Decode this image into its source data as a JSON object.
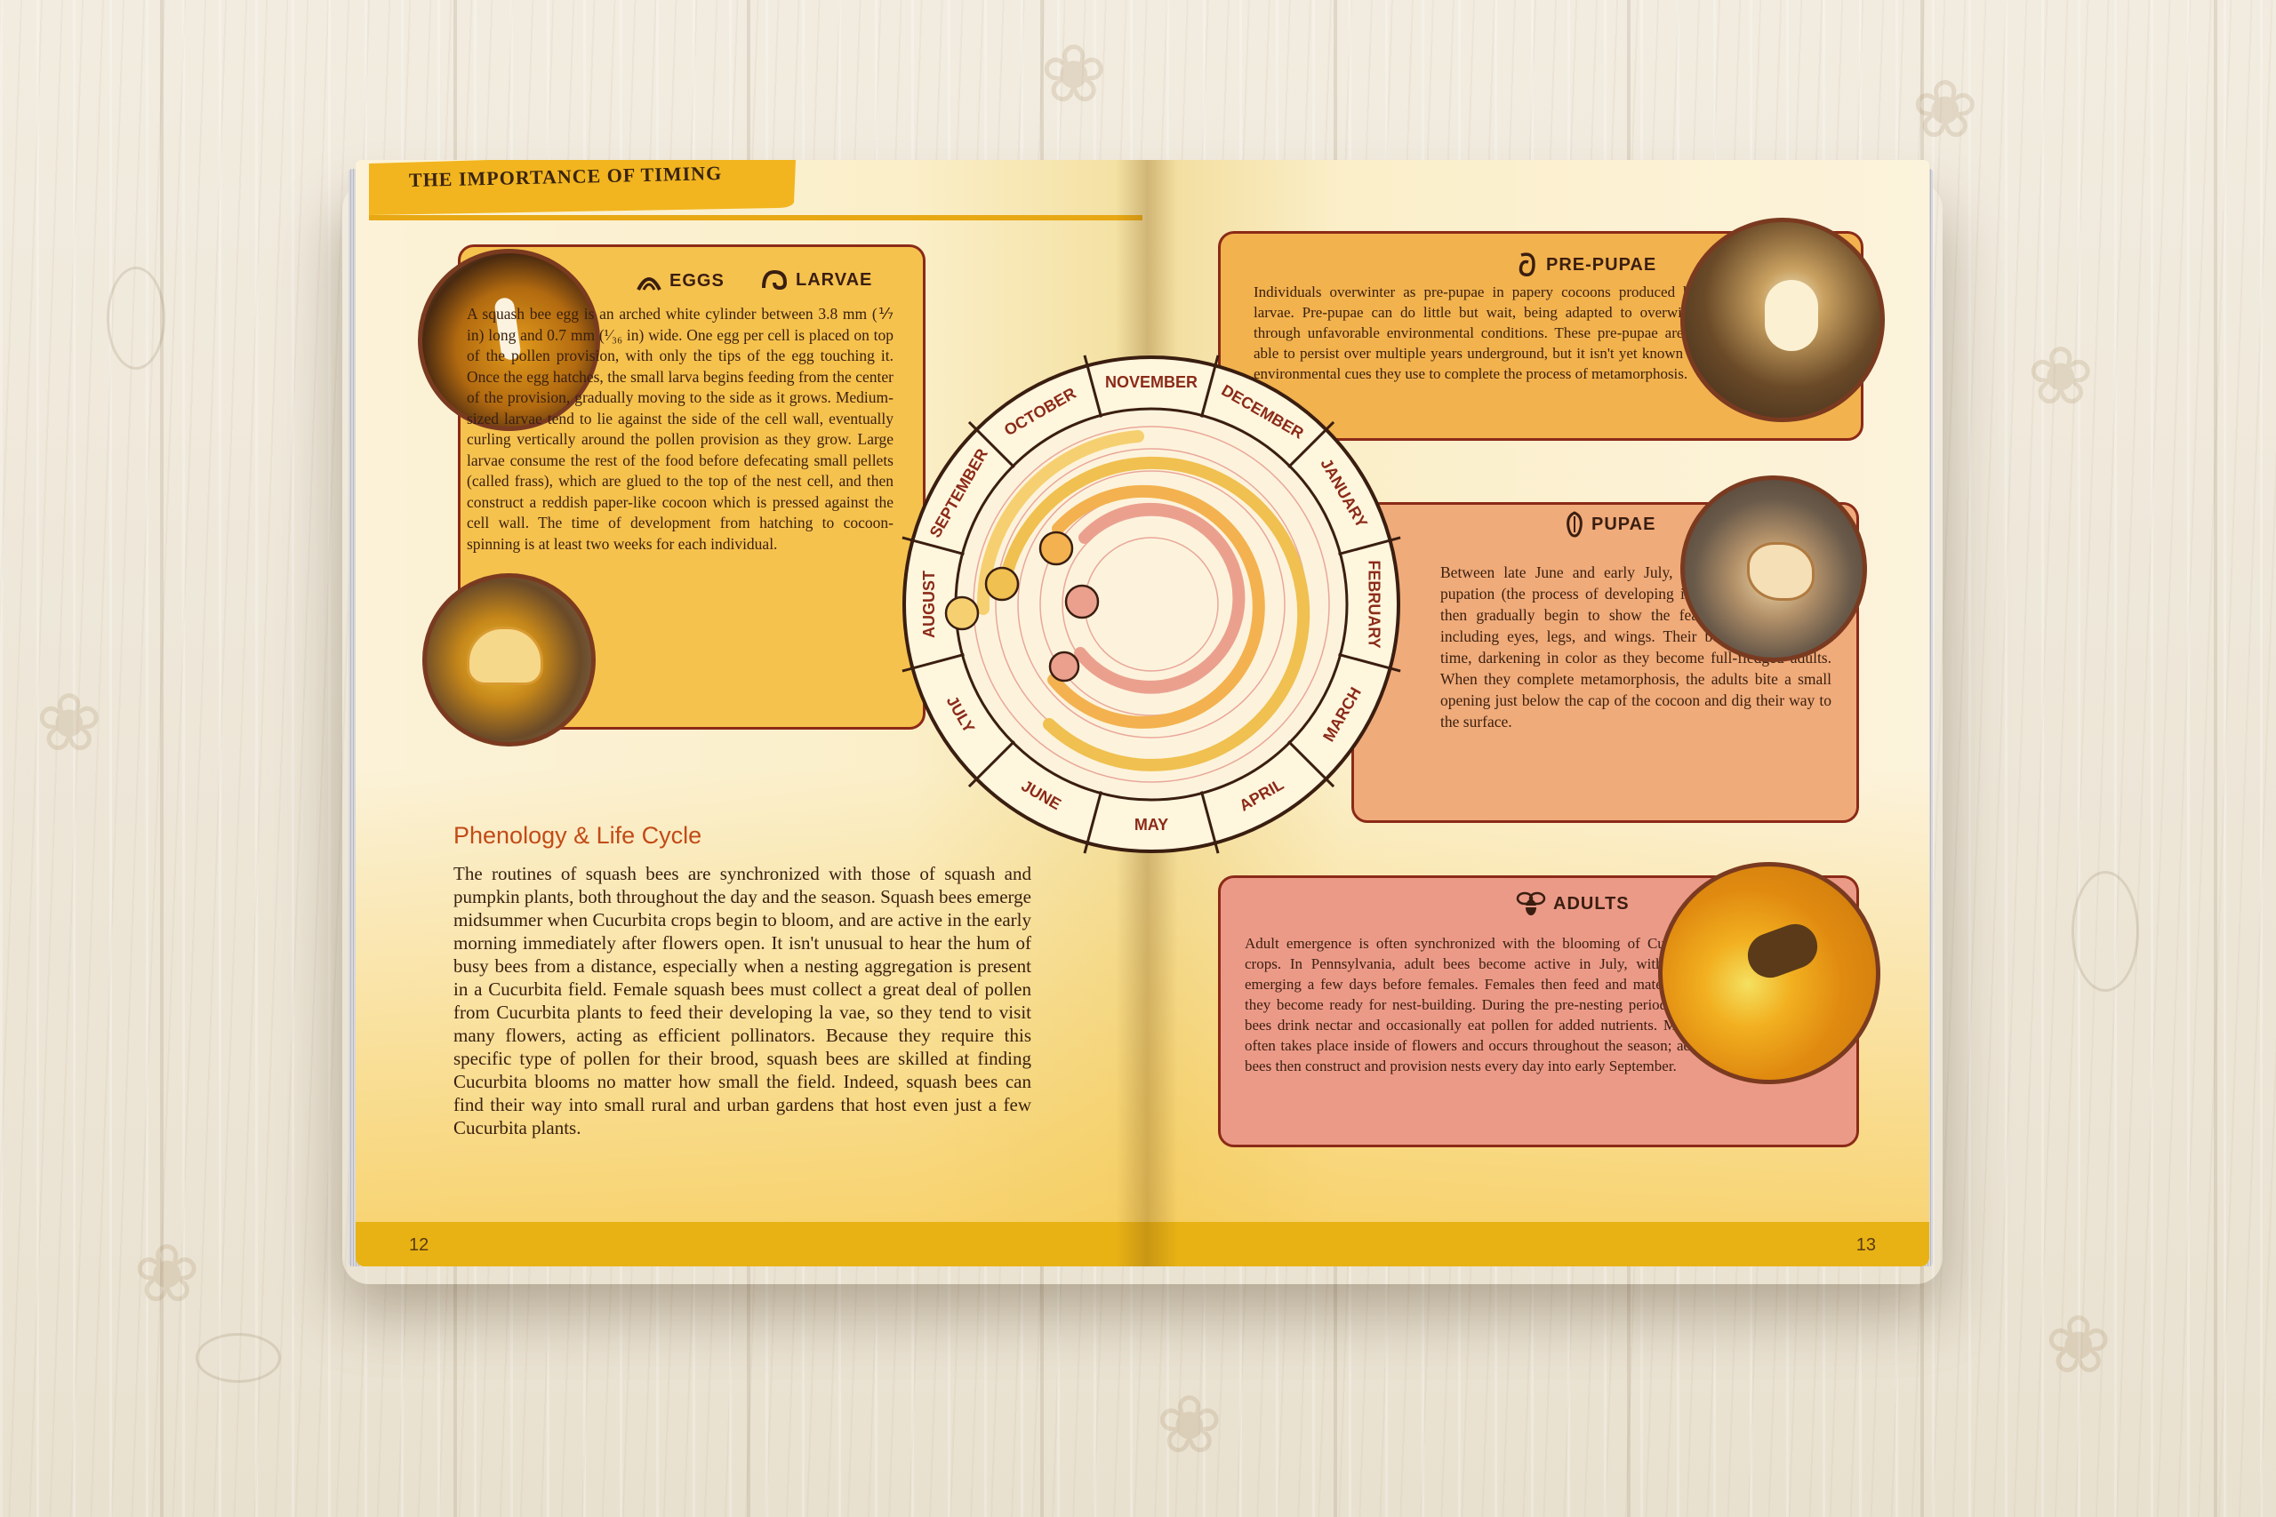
{
  "header": {
    "title": "THE IMPORTANCE OF TIMING"
  },
  "eggs_larvae": {
    "eggs_label": "EGGS",
    "larvae_label": "LARVAE",
    "text": "A squash bee egg is an arched white cylinder between 3.8 mm (⅐ in) long and 0.7 mm (¹⁄₃₆ in) wide. One egg per cell is placed on top of the pollen provision, with only the tips of the egg touching it. Once the egg hatches, the small larva begins feeding from the center of the provision, gradually moving to the side as it grows. Medium-sized larvae tend to lie against the side of the cell wall, eventually curling vertically around the pollen provision as they grow. Large larvae consume the rest of the food before defecating small pellets (called frass), which are glued to the top of the nest cell, and then construct a reddish paper-like cocoon which is pressed against the cell wall. The time of development from hatching to cocoon-spinning is at least two weeks for each individual."
  },
  "phenology": {
    "title": "Phenology & Life Cycle",
    "text": "The routines of squash bees are synchronized with those of squash and pumpkin plants, both throughout the day and the season. Squash bees emerge midsummer when Cucurbita crops begin to bloom, and are active in the early morning immediately after flowers open. It isn't unusual to hear the hum of busy bees from a distance, especially when a nesting aggregation is present in a Cucurbita field. Female squash bees must collect a great deal of pollen from Cucurbita plants to feed their developing la vae, so they tend to visit many flowers, acting as efficient pollinators. Because they require this specific type of pollen for their brood, squash bees are skilled at finding Cucurbita blooms no matter how small the field. Indeed, squash bees can find their way into small rural and urban gardens that host even just a few Cucurbita plants."
  },
  "months": [
    "SEPTEMBER",
    "OCTOBER",
    "NOVEMBER",
    "DECEMBER",
    "JANUARY",
    "FEBRUARY",
    "MARCH",
    "APRIL",
    "MAY",
    "JUNE",
    "JULY",
    "AUGUST"
  ],
  "prepupae": {
    "label": "PRE-PUPAE",
    "text": "Individuals overwinter as pre-pupae in papery cocoons produced by the larvae. Pre-pupae can do little but wait, being adapted to overwintering through unfavorable environmental conditions. These pre-pupae are likely able to persist over multiple years underground, but it isn't yet known which environmental cues they use to complete the process of metamorphosis."
  },
  "pupae": {
    "label": "PUPAE",
    "text": "Between late June and early July, the pre-pupae undergo pupation (the process of developing into pupae). The pupae then gradually begin to show the features of adult bees, including eyes, legs, and wings. Their bodies harden over time, darkening in color as they become full-fledged adults. When they complete metamorphosis, the adults bite a small opening just below the cap of the cocoon and dig their way to the surface."
  },
  "adults": {
    "label": "ADULTS",
    "text": "Adult emergence is often synchronized with the blooming of Cucurbita crops. In Pennsylvania, adult bees become active in July, with males emerging a few days before females. Females then feed and mate before they become ready for nest-building. During the pre-nesting period, adult bees drink nectar and occasionally eat pollen for added nutrients. Mating often takes place inside of flowers and occurs throughout the season; adult bees then construct and provision nests every day into early September."
  },
  "page_numbers": {
    "left": "12",
    "right": "13"
  },
  "colors": {
    "accent": "#e8b214",
    "border": "#8b2a18",
    "heading": "#c24b17"
  }
}
